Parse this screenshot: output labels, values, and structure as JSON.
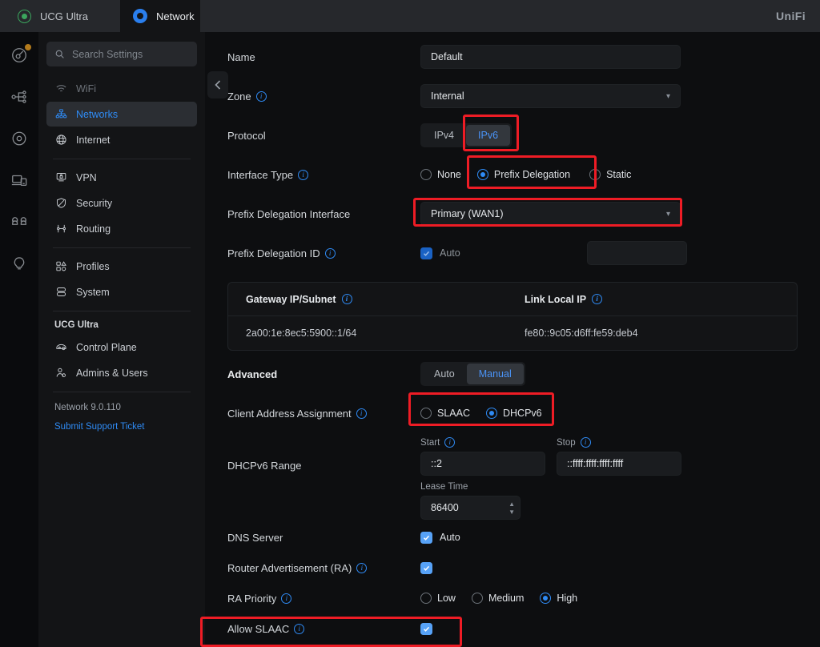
{
  "topbar": {
    "console_tab": "UCG Ultra",
    "network_tab": "Network",
    "brand": "UniFi"
  },
  "sidebar": {
    "search_placeholder": "Search Settings",
    "items": [
      {
        "label": "WiFi",
        "icon": "wifi-icon",
        "state": "muted"
      },
      {
        "label": "Networks",
        "icon": "networks-icon",
        "state": "active"
      },
      {
        "label": "Internet",
        "icon": "globe-icon",
        "state": "normal"
      },
      {
        "label": "VPN",
        "icon": "vpn-icon",
        "state": "normal"
      },
      {
        "label": "Security",
        "icon": "shield-icon",
        "state": "normal"
      },
      {
        "label": "Routing",
        "icon": "routing-icon",
        "state": "normal"
      },
      {
        "label": "Profiles",
        "icon": "profiles-icon",
        "state": "normal"
      },
      {
        "label": "System",
        "icon": "system-icon",
        "state": "normal"
      }
    ],
    "device_header": "UCG Ultra",
    "device_items": [
      {
        "label": "Control Plane",
        "icon": "control-plane-icon"
      },
      {
        "label": "Admins & Users",
        "icon": "admins-users-icon"
      }
    ],
    "version": "Network 9.0.110",
    "support_link": "Submit Support Ticket"
  },
  "form": {
    "name": {
      "label": "Name",
      "value": "Default"
    },
    "zone": {
      "label": "Zone",
      "value": "Internal"
    },
    "protocol": {
      "label": "Protocol",
      "options": [
        "IPv4",
        "IPv6"
      ],
      "selected": "IPv6"
    },
    "interface_type": {
      "label": "Interface Type",
      "options": [
        "None",
        "Prefix Delegation",
        "Static"
      ],
      "selected": "Prefix Delegation"
    },
    "prefix_delegation_interface": {
      "label": "Prefix Delegation Interface",
      "value": "Primary (WAN1)"
    },
    "prefix_delegation_id": {
      "label": "Prefix Delegation ID",
      "auto_label": "Auto",
      "auto_checked": true,
      "value": ""
    },
    "info_card": {
      "columns": [
        "Gateway IP/Subnet",
        "Link Local IP"
      ],
      "values": [
        "2a00:1e:8ec5:5900::1/64",
        "fe80::9c05:d6ff:fe59:deb4"
      ]
    },
    "advanced": {
      "label": "Advanced",
      "options": [
        "Auto",
        "Manual"
      ],
      "selected": "Manual"
    },
    "client_address_assignment": {
      "label": "Client Address Assignment",
      "options": [
        "SLAAC",
        "DHCPv6"
      ],
      "selected": "DHCPv6"
    },
    "dhcpv6_range": {
      "label": "DHCPv6 Range",
      "start_label": "Start",
      "start_value": "::2",
      "stop_label": "Stop",
      "stop_value": "::ffff:ffff:ffff:ffff"
    },
    "lease_time": {
      "label": "Lease Time",
      "value": "86400"
    },
    "dns_server": {
      "label": "DNS Server",
      "auto_label": "Auto",
      "checked": true
    },
    "router_advertisement": {
      "label": "Router Advertisement (RA)",
      "checked": true
    },
    "ra_priority": {
      "label": "RA Priority",
      "options": [
        "Low",
        "Medium",
        "High"
      ],
      "selected": "High"
    },
    "allow_slaac": {
      "label": "Allow SLAAC",
      "checked": true
    }
  }
}
